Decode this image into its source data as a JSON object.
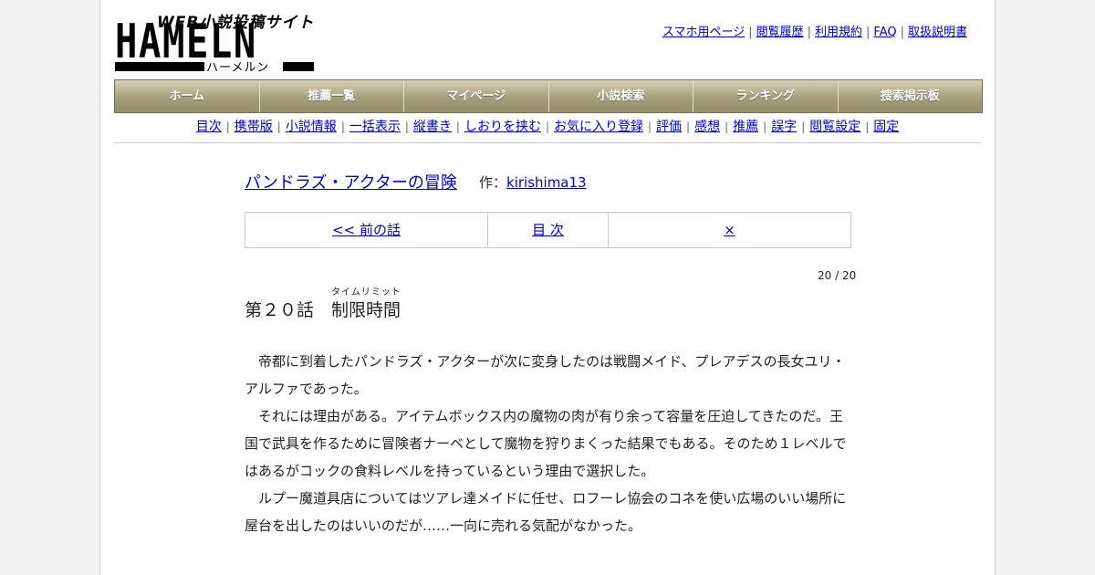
{
  "logo": {
    "main": "HAMELN",
    "tagline": "WEB小説投稿サイト",
    "kana": "ハーメルン"
  },
  "header_links": [
    "スマホ用ページ",
    "閲覧履歴",
    "利用規約",
    "FAQ",
    "取扱説明書"
  ],
  "main_nav": [
    "ホーム",
    "推薦一覧",
    "マイページ",
    "小説検索",
    "ランキング",
    "捜索掲示板"
  ],
  "sub_nav": [
    "目次",
    "携帯版",
    "小説情報",
    "一括表示",
    "縦書き",
    "しおりを挟む",
    "お気に入り登録",
    "評価",
    "感想",
    "推薦",
    "誤字",
    "閲覧設定",
    "固定"
  ],
  "novel": {
    "title": "パンドラズ・アクターの冒険",
    "author_prefix": "作：",
    "author": "kirishima13"
  },
  "chapter_nav": {
    "prev": "<< 前の話",
    "toc": "目 次",
    "close": "×"
  },
  "pager": "20 / 20",
  "chapter": {
    "number": "第２０話",
    "title": "制限時間",
    "ruby": "タイムリミット"
  },
  "body": [
    "　帝都に到着したパンドラズ・アクターが次に変身したのは戦闘メイド、プレアデスの長女ユリ・アルファであった。",
    "　それには理由がある。アイテムボックス内の魔物の肉が有り余って容量を圧迫してきたのだ。王国で武具を作るために冒険者ナーベとして魔物を狩りまくった結果でもある。そのため１レベルではあるがコックの食料レベルを持っているという理由で選択した。",
    "　ルプー魔道具店についてはツアレ達メイドに任せ、ロフーレ協会のコネを使い広場のいい場所に屋台を出したのはいいのだが……一向に売れる気配がなかった。"
  ]
}
